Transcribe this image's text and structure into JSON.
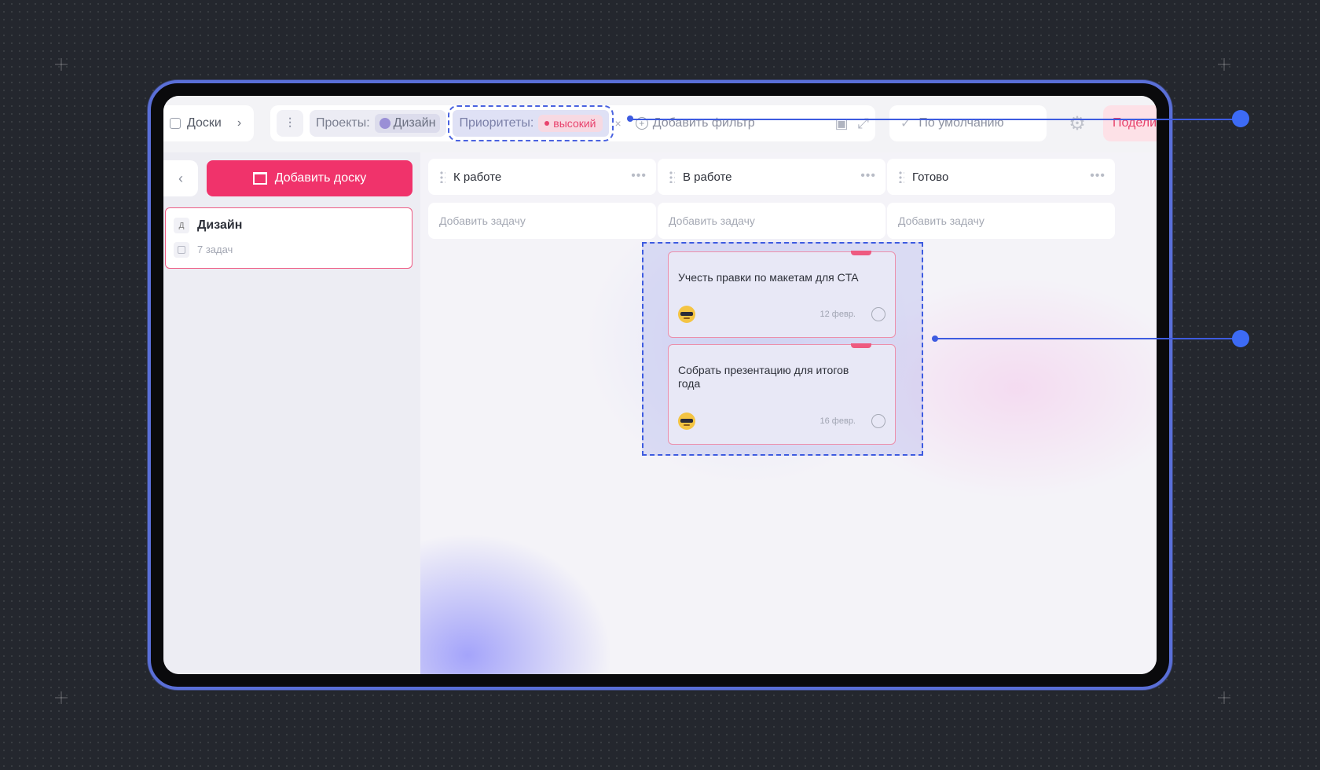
{
  "breadcrumb": {
    "label": "Доски"
  },
  "filters": {
    "projects_label": "Проекты:",
    "projects_value": "Дизайн",
    "priorities_label": "Приоритеты:",
    "priorities_value": "высокий",
    "add_filter": "Добавить фильтр"
  },
  "sort": {
    "label": "По умолчанию"
  },
  "share": {
    "label": "Подели"
  },
  "sidebar": {
    "add_board": "Добавить доску",
    "boards": [
      {
        "letter": "Д",
        "name": "Дизайн",
        "count": "7 задач"
      }
    ]
  },
  "columns": [
    {
      "title": "К работе",
      "add_task": "Добавить задачу"
    },
    {
      "title": "В работе",
      "add_task": "Добавить задачу"
    },
    {
      "title": "Готово",
      "add_task": "Добавить задачу"
    }
  ],
  "tasks": [
    {
      "title": "Учесть правки по макетам для CTA",
      "date": "12 февр."
    },
    {
      "title": "Собрать презентацию для итогов года",
      "date": "16 февр."
    }
  ],
  "colors": {
    "accent": "#f0336b",
    "selection": "#3d5be0",
    "device_border": "#5a6fd8"
  }
}
